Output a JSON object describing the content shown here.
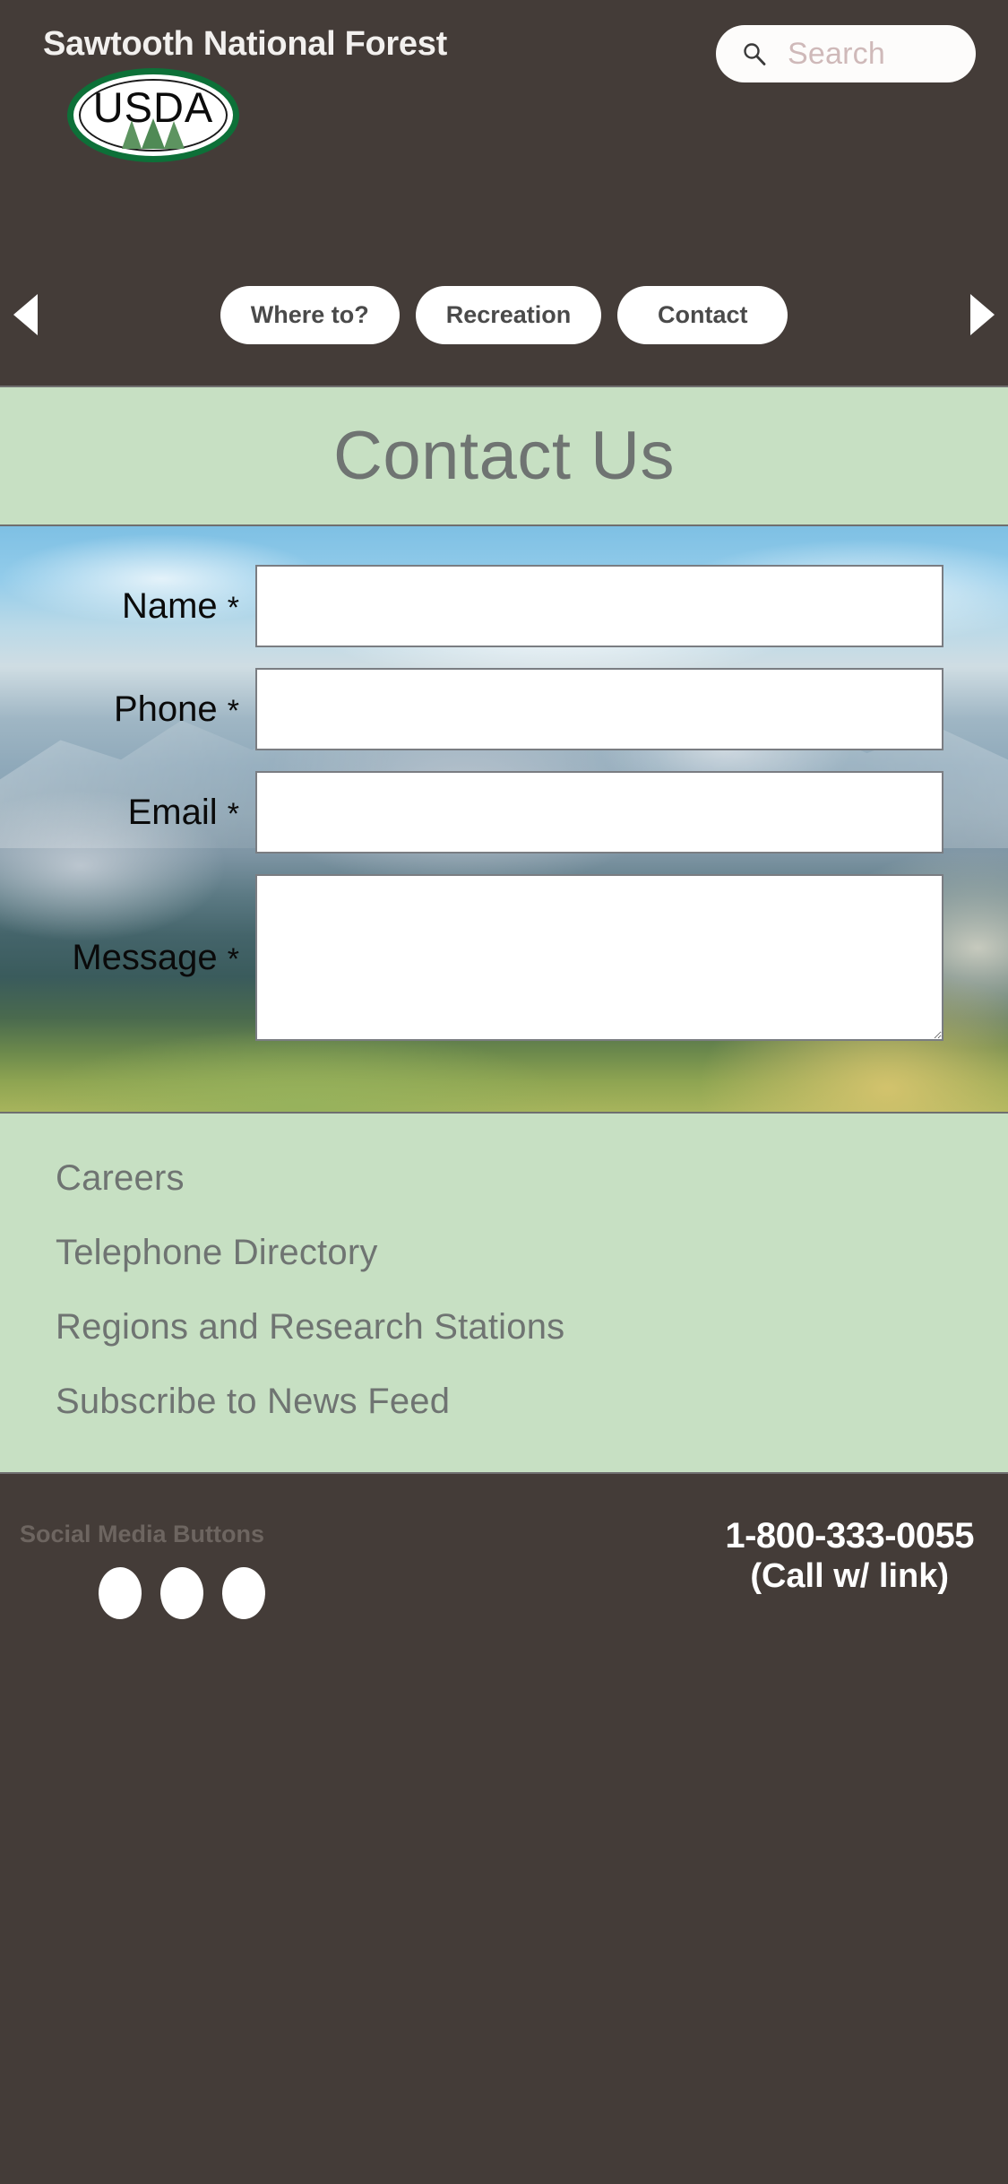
{
  "header": {
    "site_title": "Sawtooth National Forest",
    "logo_text": "USDA",
    "logo_ring_color": "#0d7038",
    "search": {
      "placeholder": "Search",
      "icon": "search-icon"
    }
  },
  "nav": {
    "prev_arrow_icon": "triangle-left-icon",
    "next_arrow_icon": "triangle-right-icon",
    "items": [
      {
        "label": "Where to?"
      },
      {
        "label": "Recreation"
      },
      {
        "label": "Contact"
      }
    ]
  },
  "page": {
    "title": "Contact Us",
    "band_color": "#c7e0c3",
    "title_color": "#6f7472"
  },
  "form": {
    "fields": [
      {
        "label": "Name",
        "required_mark": "*",
        "value": "",
        "placeholder": "",
        "type": "text"
      },
      {
        "label": "Phone",
        "required_mark": "*",
        "value": "",
        "placeholder": "",
        "type": "tel"
      },
      {
        "label": "Email",
        "required_mark": "*",
        "value": "",
        "placeholder": "",
        "type": "email"
      },
      {
        "label": "Message",
        "required_mark": "*",
        "value": "",
        "placeholder": "",
        "type": "textarea"
      }
    ]
  },
  "links": {
    "items": [
      {
        "label": "Careers"
      },
      {
        "label": "Telephone Directory"
      },
      {
        "label": "Regions and Research Stations"
      },
      {
        "label": "Subscribe to News Feed"
      }
    ]
  },
  "footer": {
    "social_label": "Social Media Buttons",
    "social_buttons": [
      {
        "name": "social-button-1"
      },
      {
        "name": "social-button-2"
      },
      {
        "name": "social-button-3"
      }
    ],
    "phone_number": "1-800-333-0055",
    "phone_note": "(Call w/ link)",
    "background_color": "#443c38"
  }
}
